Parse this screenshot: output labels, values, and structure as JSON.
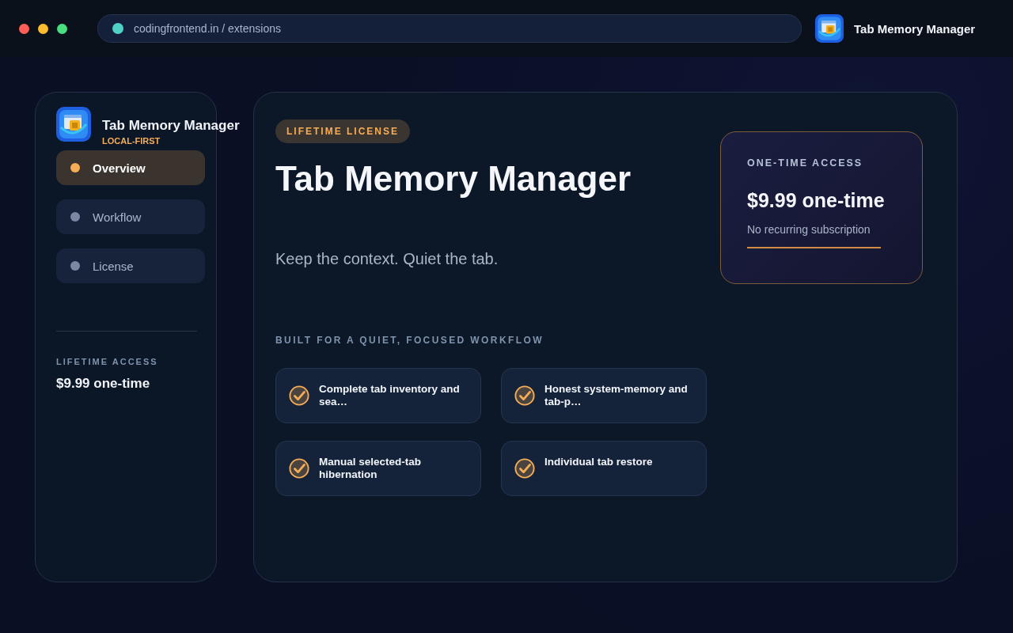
{
  "window": {
    "controls": [
      {
        "color": "#ff5f57"
      },
      {
        "color": "#febc2e"
      },
      {
        "color": "#4ade80"
      }
    ]
  },
  "address_bar": {
    "url": "codingfrontend.in / extensions",
    "color": "#4fd1c5"
  },
  "header": {
    "title": "Tab Memory Manager"
  },
  "sidebar": {
    "title": "Tab Memory Manager",
    "subtitle": "LOCAL-FIRST",
    "items": [
      {
        "label": "Overview",
        "selected": true
      },
      {
        "label": "Workflow",
        "selected": false
      },
      {
        "label": "License",
        "selected": false
      }
    ],
    "footer_label": "LIFETIME ACCESS",
    "footer_price": "$9.99 one-time"
  },
  "main": {
    "badge": "LIFETIME LICENSE",
    "title": "Tab Memory Manager",
    "tagline": "Keep the context. Quiet the tab.",
    "section_label": "BUILT FOR A QUIET, FOCUSED WORKFLOW",
    "features": [
      {
        "text": "Complete tab inventory and sea…"
      },
      {
        "text": "Honest system-memory and tab-p…"
      },
      {
        "text": "Manual selected-tab hibernation"
      },
      {
        "text": "Individual tab restore"
      }
    ]
  },
  "price_card": {
    "label": "ONE-TIME ACCESS",
    "price": "$9.99 one-time",
    "note": "No recurring subscription"
  }
}
